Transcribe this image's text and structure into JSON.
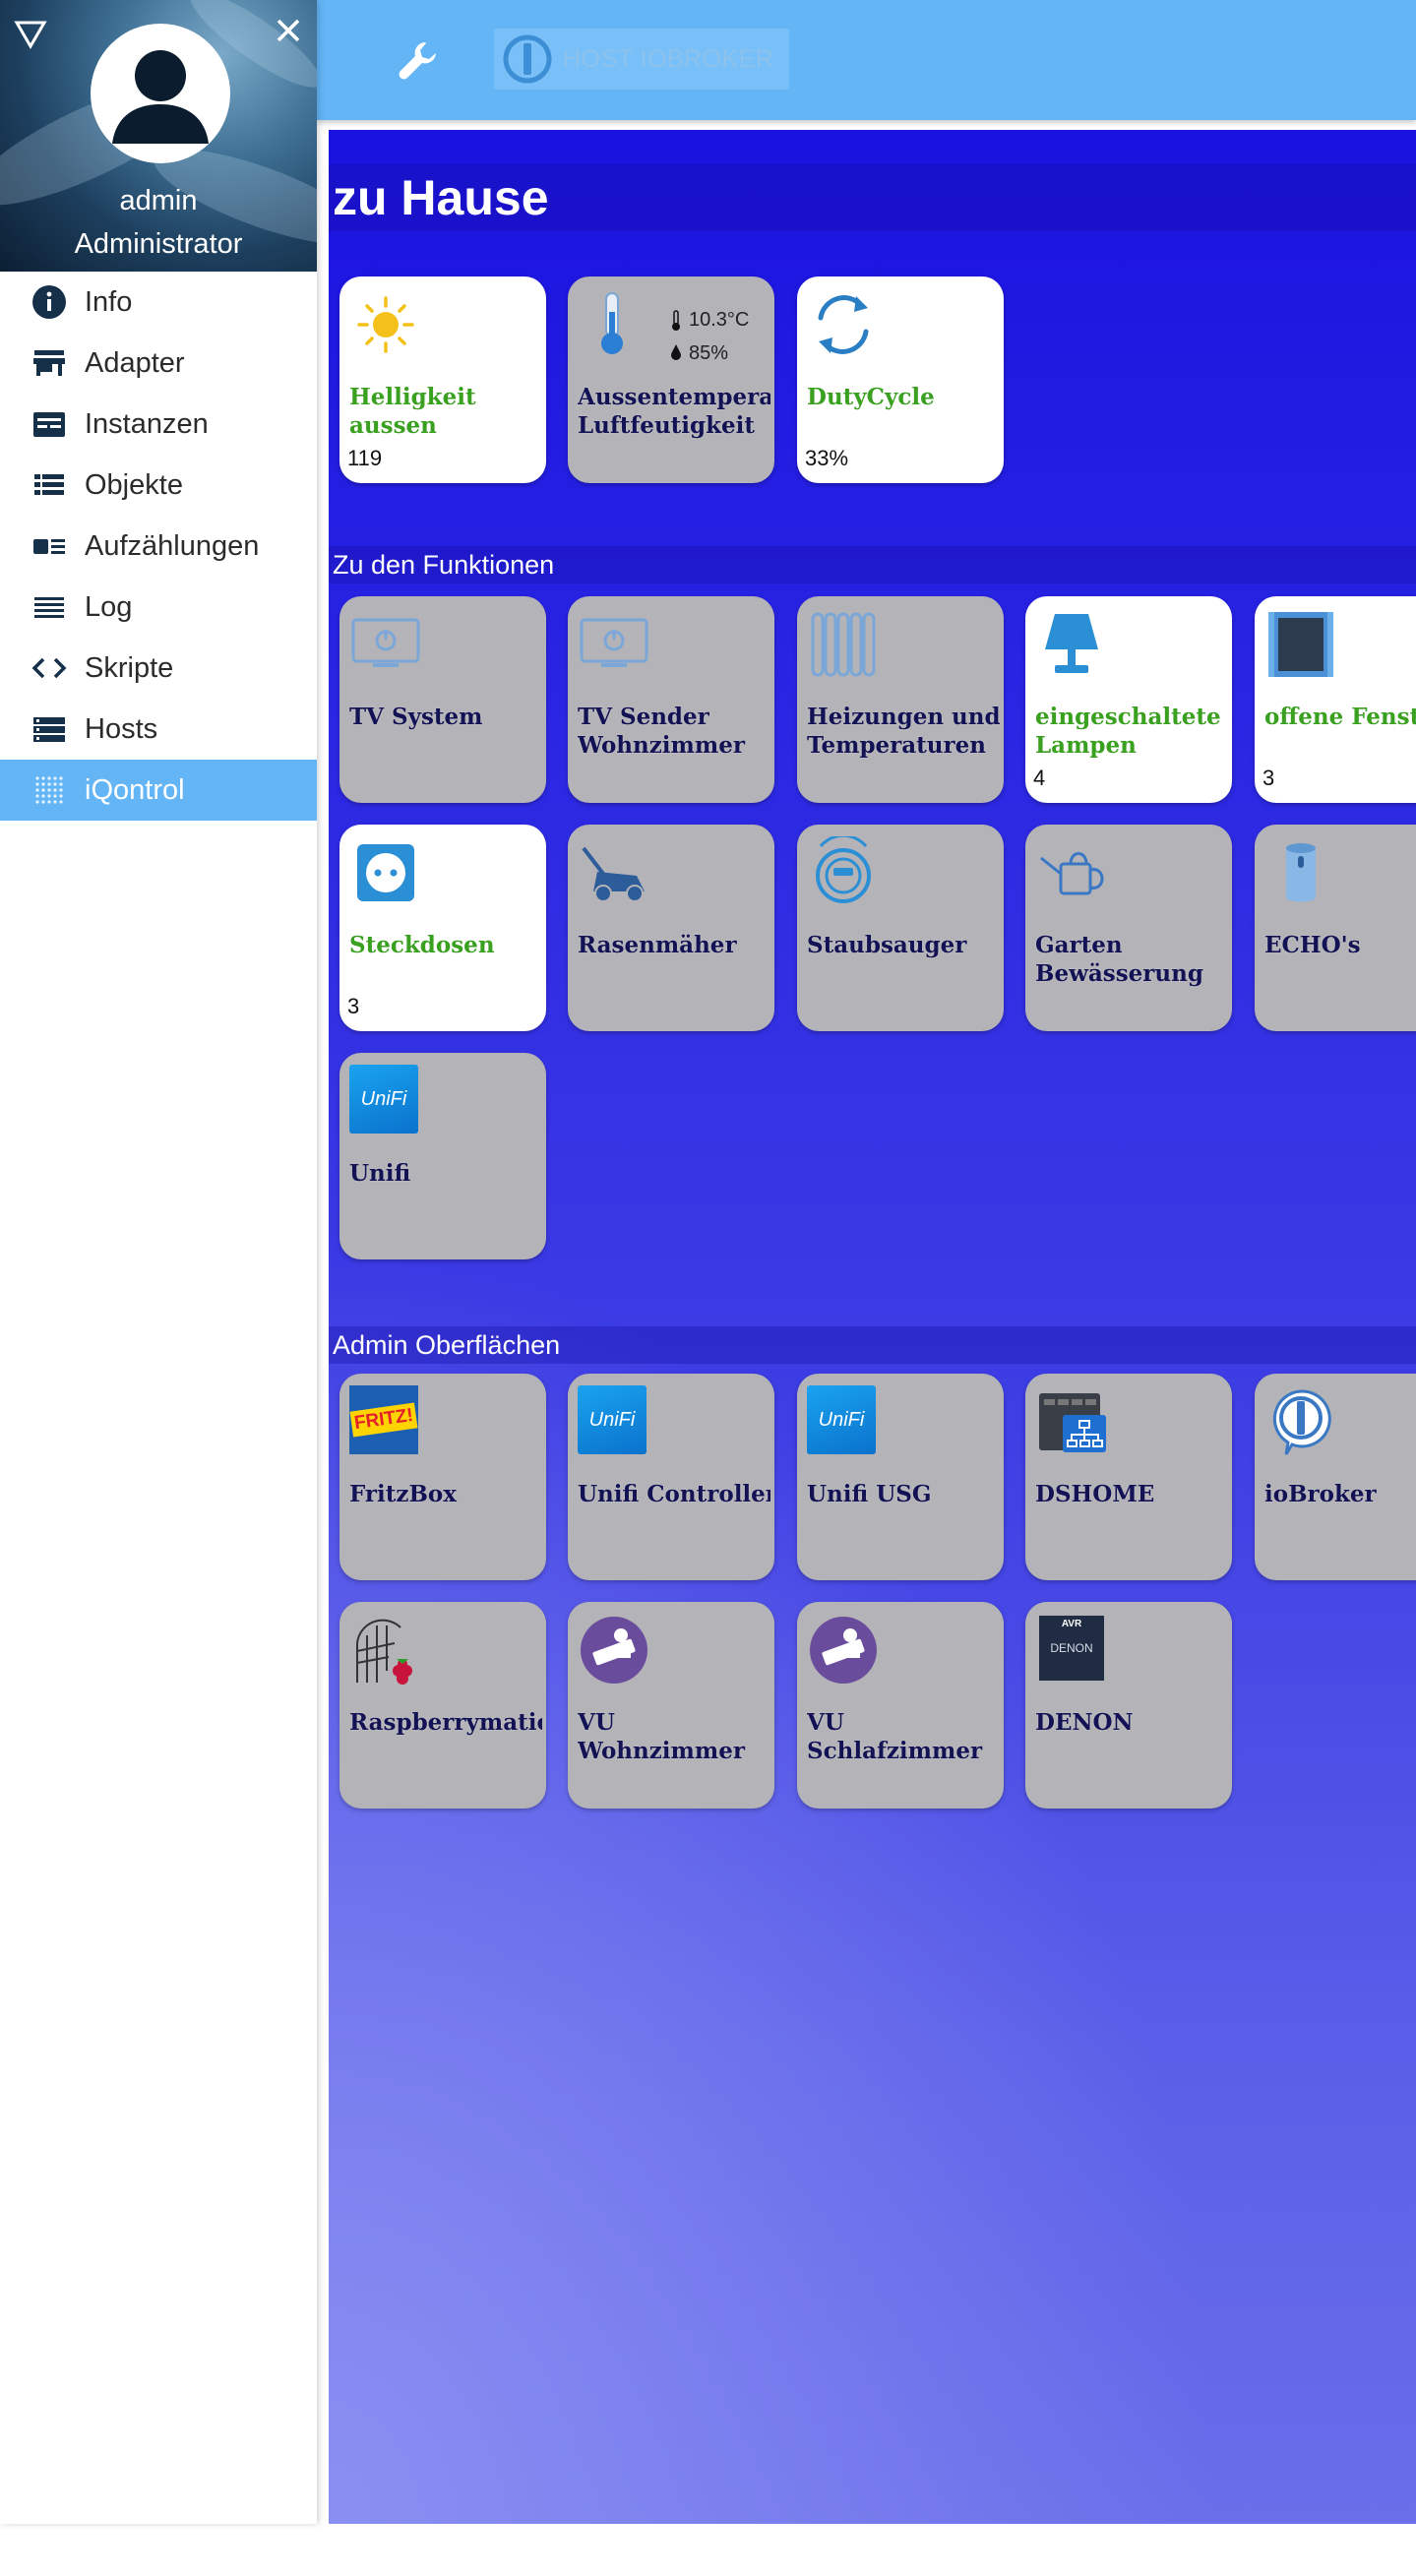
{
  "sidebar": {
    "user_name": "admin",
    "user_role": "Administrator",
    "items": [
      {
        "label": "Info",
        "icon": "info-icon"
      },
      {
        "label": "Adapter",
        "icon": "store-icon"
      },
      {
        "label": "Instanzen",
        "icon": "instances-icon"
      },
      {
        "label": "Objekte",
        "icon": "list-icon"
      },
      {
        "label": "Aufzählungen",
        "icon": "enum-icon"
      },
      {
        "label": "Log",
        "icon": "log-icon"
      },
      {
        "label": "Skripte",
        "icon": "code-icon"
      },
      {
        "label": "Hosts",
        "icon": "hosts-icon"
      },
      {
        "label": "iQontrol",
        "icon": "iqontrol-icon",
        "active": true
      }
    ]
  },
  "topbar": {
    "host_label": "HOST IOBROKER"
  },
  "content": {
    "sections": [
      {
        "title": "zu Hause",
        "tiles": [
          {
            "name": "Helligkeit\naussen",
            "value": "119",
            "active": true,
            "icon": "sun-icon"
          },
          {
            "name": "Aussentemperatur\nLuftfeutigkeit",
            "temperature": "10.3°C",
            "humidity": "85%",
            "active": false,
            "icon": "thermometer-icon"
          },
          {
            "name": "DutyCycle",
            "value": "33%",
            "active": true,
            "icon": "sync-icon"
          }
        ]
      },
      {
        "title": "Zu den Funktionen",
        "tiles": [
          {
            "name": "TV System",
            "active": false,
            "icon": "tv-icon"
          },
          {
            "name": "TV Sender\nWohnzimmer",
            "active": false,
            "icon": "tv-icon"
          },
          {
            "name": "Heizungen und\nTemperaturen",
            "active": false,
            "icon": "radiator-icon"
          },
          {
            "name": "eingeschaltete\nLampen",
            "value": "4",
            "active": true,
            "icon": "lamp-icon"
          },
          {
            "name": "offene Fenster",
            "value": "3",
            "active": true,
            "icon": "window-icon"
          },
          {
            "name": "Steckdosen",
            "value": "3",
            "active": true,
            "icon": "socket-icon"
          },
          {
            "name": "Rasenmäher",
            "active": false,
            "icon": "mower-icon"
          },
          {
            "name": "Staubsauger",
            "active": false,
            "icon": "vacuum-icon"
          },
          {
            "name": "Garten\nBewässerung",
            "active": false,
            "icon": "watering-can-icon"
          },
          {
            "name": "ECHO's",
            "active": false,
            "icon": "echo-icon"
          },
          {
            "name": "Unifi",
            "active": false,
            "icon": "unifi-icon"
          }
        ]
      },
      {
        "title": "Admin Oberflächen",
        "tiles": [
          {
            "name": "FritzBox",
            "active": false,
            "icon": "fritz-icon"
          },
          {
            "name": "Unifi Controller",
            "active": false,
            "icon": "unifi-icon"
          },
          {
            "name": "Unifi USG",
            "active": false,
            "icon": "unifi-icon"
          },
          {
            "name": "DSHOME",
            "active": false,
            "icon": "nas-icon"
          },
          {
            "name": "ioBroker",
            "active": false,
            "icon": "iobroker-icon"
          },
          {
            "name": "Raspberrymatic",
            "active": false,
            "icon": "raspberry-icon"
          },
          {
            "name": "VU\nWohnzimmer",
            "active": false,
            "icon": "remote-icon"
          },
          {
            "name": "VU\nSchlafzimmer",
            "active": false,
            "icon": "remote-icon"
          },
          {
            "name": "DENON",
            "active": false,
            "icon": "avr-icon"
          }
        ]
      }
    ],
    "icon_labels": {
      "unifi": "UniFi",
      "fritz": "FRITZ!",
      "avr_top": "AVR",
      "avr_brand": "DENON"
    }
  }
}
